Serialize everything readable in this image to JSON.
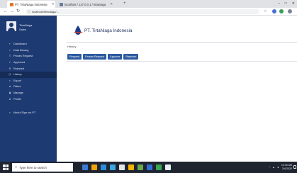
{
  "browser": {
    "tabs": [
      {
        "title": "PT. TirtaNiaga Indonesia",
        "favicon_color": "#e8741d"
      },
      {
        "title": "localhost / 127.0.0.1 / tirtaniaga",
        "favicon_color": "#6c7a99"
      }
    ],
    "new_tab": "+",
    "window_controls": {
      "minimize": "–",
      "maximize": "□",
      "close": "✕"
    },
    "url": "localhost/tirtaniaga/..."
  },
  "user": {
    "name": "TirtaNiaga",
    "role": "Sales"
  },
  "menu": [
    {
      "label": "Dashboard",
      "icon": "dashboard-icon",
      "glyph": "▪"
    },
    {
      "label": "Data Barang",
      "icon": "box-icon",
      "glyph": "▪"
    },
    {
      "label": "Proses Request",
      "icon": "list-icon",
      "glyph": "≡"
    },
    {
      "label": "Approved",
      "icon": "check-icon",
      "glyph": "✓"
    },
    {
      "label": "Rejected",
      "icon": "x-icon",
      "glyph": "✕"
    },
    {
      "label": "History",
      "icon": "clock-icon",
      "glyph": "◷",
      "active": true
    },
    {
      "label": "Export",
      "icon": "export-icon",
      "glyph": "▪"
    },
    {
      "label": "Filters",
      "icon": "filter-icon",
      "glyph": "▾"
    },
    {
      "label": "Manage",
      "icon": "person-icon",
      "glyph": "♟"
    },
    {
      "label": "Profile",
      "icon": "profile-icon",
      "glyph": "●"
    },
    {
      "label": "Modul Sign out PT",
      "icon": "logout-icon",
      "glyph": "▪",
      "gap": true
    }
  ],
  "header": {
    "company": "PT. TirtaNiaga Indonesia"
  },
  "panel": {
    "title": "History",
    "buttons": [
      "Request",
      "Proses Request",
      "Approve",
      "Rejected"
    ]
  },
  "taskbar": {
    "search_placeholder": "Type here to search",
    "app_colors": [
      "#3a7bd5",
      "#f0a30a",
      "#2a8de0",
      "#3ea6e0",
      "#e3e5e8",
      "#f4b400",
      "#6aa84f",
      "#2f6fd6",
      "#36a852",
      "#e9f0f8"
    ],
    "time": "10:40 AM",
    "date": "3/4/2020"
  },
  "colors": {
    "sidebar": "#1e3a72",
    "sidebar_active": "#152b58",
    "button": "#2c5aa0",
    "taskbar": "#1f2530"
  }
}
